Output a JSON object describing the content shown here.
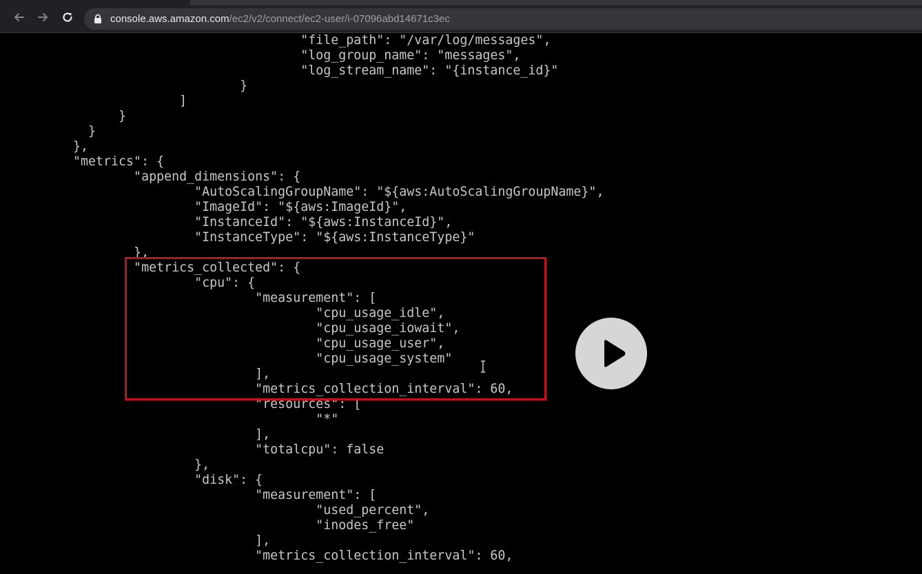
{
  "browser": {
    "url_host": "console.aws.amazon.com",
    "url_path": "/ec2/v2/connect/ec2-user/i-07096abd14671c3ec",
    "icons": [
      "back-arrow-icon",
      "forward-arrow-icon",
      "reload-icon",
      "lock-icon"
    ]
  },
  "terminal": {
    "lines": [
      "                                \"file_path\": \"/var/log/messages\",",
      "                                \"log_group_name\": \"messages\",",
      "                                \"log_stream_name\": \"{instance_id}\"",
      "                        }",
      "                ]",
      "        }",
      "    }",
      "  },",
      "  \"metrics\": {",
      "          \"append_dimensions\": {",
      "                  \"AutoScalingGroupName\": \"${aws:AutoScalingGroupName}\",",
      "                  \"ImageId\": \"${aws:ImageId}\",",
      "                  \"InstanceId\": \"${aws:InstanceId}\",",
      "                  \"InstanceType\": \"${aws:InstanceType}\"",
      "          },",
      "          \"metrics_collected\": {",
      "                  \"cpu\": {",
      "                          \"measurement\": [",
      "                                  \"cpu_usage_idle\",",
      "                                  \"cpu_usage_iowait\",",
      "                                  \"cpu_usage_user\",",
      "                                  \"cpu_usage_system\"",
      "                          ],",
      "                          \"metrics_collection_interval\": 60,",
      "                          \"resources\": [",
      "                                  \"*\"",
      "                          ],",
      "                          \"totalcpu\": false",
      "                  },",
      "                  \"disk\": {",
      "                          \"measurement\": [",
      "                                  \"used_percent\",",
      "                                  \"inodes_free\"",
      "                          ],",
      "                          \"metrics_collection_interval\": 60,"
    ]
  },
  "overlay": {
    "highlight_color": "#c1121f",
    "play_button_icon": "play-icon",
    "cursor_icon": "text-cursor-icon"
  }
}
